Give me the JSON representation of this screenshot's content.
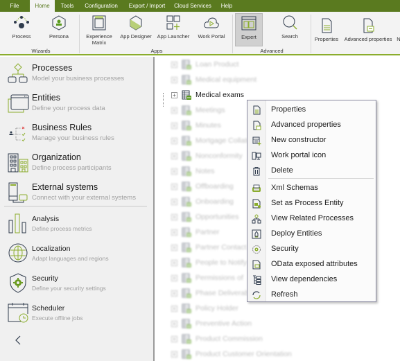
{
  "menubar": {
    "tabs": [
      {
        "label": "File",
        "active": false
      },
      {
        "label": "Home",
        "active": true
      },
      {
        "label": "Tools",
        "active": false
      },
      {
        "label": "Configuration",
        "active": false
      },
      {
        "label": "Export / Import",
        "active": false
      },
      {
        "label": "Cloud Services",
        "active": false
      },
      {
        "label": "Help",
        "active": false
      }
    ]
  },
  "ribbon": {
    "groups": {
      "wizards": "Wizards",
      "apps": "Apps",
      "advanced": "Advanced"
    },
    "buttons": {
      "process": "Process",
      "persona": "Persona",
      "experience_matrix_1": "Experience",
      "experience_matrix_2": "Matrix",
      "app_designer": "App Designer",
      "app_launcher": "App Launcher",
      "work_portal": "Work Portal",
      "expert": "Expert",
      "search": "Search",
      "properties": "Properties",
      "advanced_properties": "Advanced properties",
      "overflow": "N"
    }
  },
  "sidebar": {
    "items": [
      {
        "title": "Processes",
        "subtitle": "Model your business processes"
      },
      {
        "title": "Entities",
        "subtitle": "Define your process data"
      },
      {
        "title": "Business Rules",
        "subtitle": "Manage your business rules"
      },
      {
        "title": "Organization",
        "subtitle": "Define process participants"
      },
      {
        "title": "External systems",
        "subtitle": "Connect with your external systems"
      },
      {
        "title": "Analysis",
        "subtitle": "Define process metrics"
      },
      {
        "title": "Localization",
        "subtitle": "Adapt languages and regions"
      },
      {
        "title": "Security",
        "subtitle": "Define your security settings"
      },
      {
        "title": "Scheduler",
        "subtitle": "Execute offline jobs"
      }
    ],
    "collapse_icon": "chevron-left-icon"
  },
  "tree": {
    "items": [
      {
        "label": "Loan Product",
        "focused": false
      },
      {
        "label": "Medical equipment",
        "focused": false
      },
      {
        "label": "Medical exams",
        "focused": true
      },
      {
        "label": "Meetings",
        "focused": false
      },
      {
        "label": "Minutes",
        "focused": false
      },
      {
        "label": "Mortgage Collateral",
        "focused": false
      },
      {
        "label": "Nonconformity",
        "focused": false
      },
      {
        "label": "Notes",
        "focused": false
      },
      {
        "label": "Offboarding",
        "focused": false
      },
      {
        "label": "Onboarding",
        "focused": false
      },
      {
        "label": "Opportunities",
        "focused": false
      },
      {
        "label": "Partner",
        "focused": false
      },
      {
        "label": "Partner Contact",
        "focused": false
      },
      {
        "label": "People to Notify",
        "focused": false
      },
      {
        "label": "Permissions of",
        "focused": false
      },
      {
        "label": "Phase Deliverable",
        "focused": false
      },
      {
        "label": "Policy Holder",
        "focused": false
      },
      {
        "label": "Preventive Action",
        "focused": false
      },
      {
        "label": "Product Commission",
        "focused": false
      },
      {
        "label": "Product Customer Orientation",
        "focused": false
      }
    ]
  },
  "context_menu": {
    "items": [
      {
        "label": "Properties",
        "icon": "properties-icon"
      },
      {
        "label": "Advanced properties",
        "icon": "advanced-properties-icon"
      },
      {
        "label": "New constructor",
        "icon": "new-constructor-icon"
      },
      {
        "label": "Work portal icon",
        "icon": "work-portal-icon"
      },
      {
        "label": "Delete",
        "icon": "trash-icon"
      },
      {
        "label": "Xml Schemas",
        "icon": "xml-schema-icon"
      },
      {
        "label": "Set as Process Entity",
        "icon": "process-entity-icon"
      },
      {
        "label": "View Related Processes",
        "icon": "hierarchy-icon"
      },
      {
        "label": "Deploy Entities",
        "icon": "deploy-icon"
      },
      {
        "label": "Security",
        "icon": "security-gear-icon"
      },
      {
        "label": "OData exposed attributes",
        "icon": "odata-icon"
      },
      {
        "label": "View dependencies",
        "icon": "dependencies-icon"
      },
      {
        "label": "Refresh",
        "icon": "refresh-icon"
      }
    ]
  },
  "colors": {
    "brand_green": "#5a7a1f",
    "accent_green": "#8bad2d",
    "icon_dark": "#2f3b4c"
  }
}
